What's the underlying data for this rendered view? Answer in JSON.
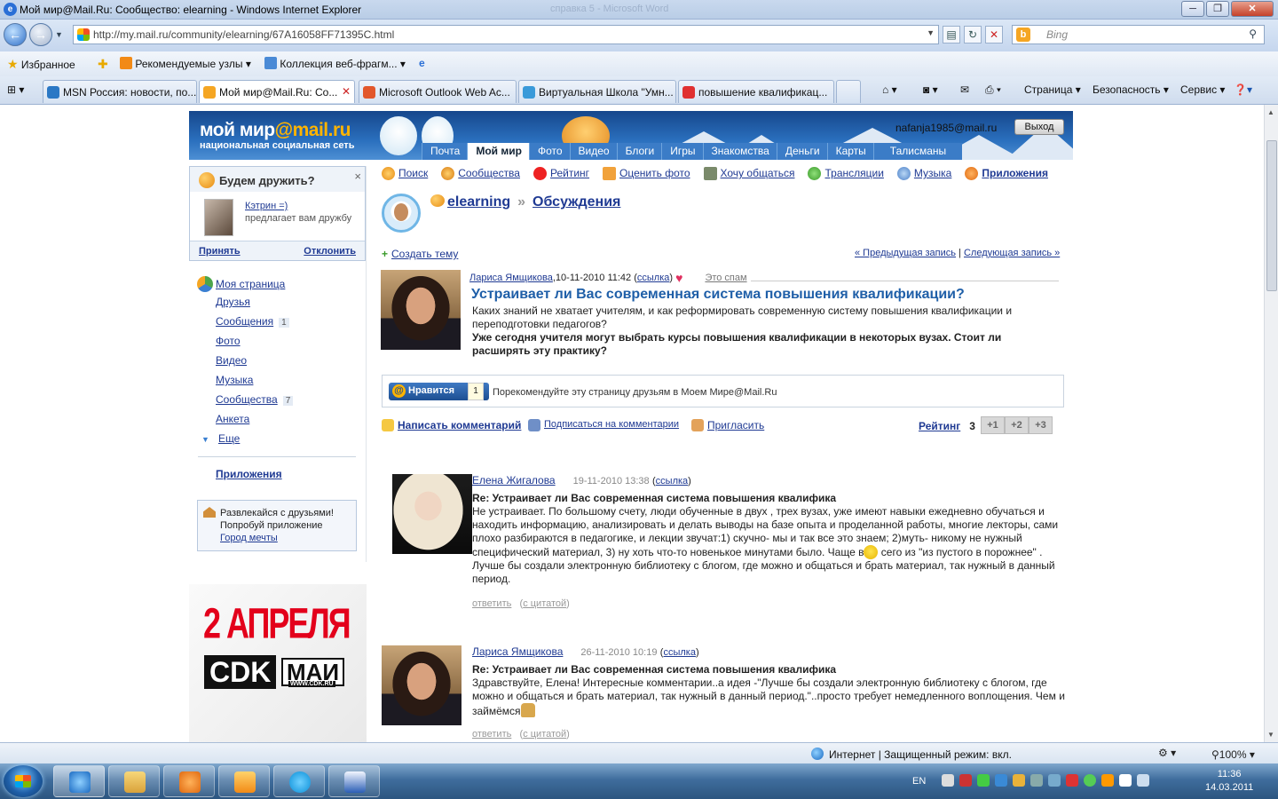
{
  "window": {
    "title": "Мой мир@Mail.Ru: Сообщество: elearning - Windows Internet Explorer",
    "ghost_title": "справка 5 - Microsoft Word",
    "minimize": "─",
    "maximize": "❐",
    "close": "✕"
  },
  "address": {
    "url": "http://my.mail.ru/community/elearning/67A16058FF71395C.html",
    "search_placeholder": "Bing"
  },
  "favorites_bar": {
    "favorites_label": "Избранное",
    "items": [
      "Рекомендуемые узлы ▾",
      "Коллекция веб-фрагм... ▾"
    ]
  },
  "tabs": [
    {
      "label": "MSN Россия: новости, по...",
      "color": "#2b78c5"
    },
    {
      "label": "Мой мир@Mail.Ru: Со...",
      "color": "#f5a623"
    },
    {
      "label": "Microsoft Outlook Web Ac...",
      "color": "#e2572b"
    },
    {
      "label": "Виртуальная Школа \"Умн...",
      "color": "#3a9ad9"
    },
    {
      "label": "повышение квалификац...",
      "color": "#e03030"
    }
  ],
  "commands": [
    "Страница ▾",
    "Безопасность ▾",
    "Сервис ▾"
  ],
  "site": {
    "logo_main": "мой мир",
    "logo_at": "@mail.ru",
    "logo_sub": "национальная социальная сеть",
    "user_email": "nafanja1985@mail.ru",
    "exit_label": "Выход",
    "nav": [
      "Почта",
      "Мой мир",
      "Фото",
      "Видео",
      "Блоги",
      "Игры",
      "Знакомства",
      "Деньги",
      "Карты",
      "Талисманы"
    ]
  },
  "friend_box": {
    "title": "Будем дружить?",
    "close": "×",
    "name": "Кэтрин =)",
    "suggest": "предлагает вам дружбу",
    "accept": "Принять",
    "decline": "Отклонить"
  },
  "left_nav": [
    {
      "label": "Моя страница",
      "count": ""
    },
    {
      "label": "Друзья",
      "count": ""
    },
    {
      "label": "Сообщения",
      "count": "1"
    },
    {
      "label": "Фото",
      "count": ""
    },
    {
      "label": "Видео",
      "count": ""
    },
    {
      "label": "Музыка",
      "count": ""
    },
    {
      "label": "Сообщества",
      "count": "7"
    },
    {
      "label": "Анкета",
      "count": ""
    },
    {
      "label": "Еще",
      "count": ""
    }
  ],
  "apps_label": "Приложения",
  "promo": {
    "line1": "Развлекайся с друзьями!",
    "line2": "Попробуй приложение",
    "link": "Город мечты"
  },
  "banner": {
    "date": "2 АПРЕЛЯ",
    "cdk": "CDK",
    "mai": "МАИ",
    "www": "WWW.CDK.RU"
  },
  "top_nav": [
    "Поиск",
    "Сообщества",
    "Рейтинг",
    "Оценить фото",
    "Хочу общаться",
    "Трансляции",
    "Музыка",
    "Приложения"
  ],
  "breadcrumb": {
    "community": "elearning",
    "sep": "»",
    "section": "Обсуждения"
  },
  "new_topic": "Создать тему",
  "prev_record": "« Предыдущая запись",
  "next_record": "Следующая запись »",
  "post": {
    "author": "Лариса Ямщикова",
    "date": ",10-11-2010 11:42",
    "link": "ссылка",
    "spam": "Это спам",
    "title": "Устраивает ли Вас современная система повышения квалификации?",
    "text": "Каких знаний не хватает учителям, и как реформировать современную систему повышения квалификации и переподготовки педагогов?",
    "bold_text": "Уже сегодня учителя могут выбрать курсы повышения квалификации в некоторых вузах. Стоит ли расширять эту практику?"
  },
  "like": {
    "button": "Нравится",
    "count": "1",
    "text": "Порекомендуйте эту страницу друзьям в Моем Мире@Mail.Ru"
  },
  "actions": {
    "comment": "Написать комментарий",
    "subscribe": "Подписаться на комментарии",
    "invite": "Пригласить"
  },
  "rating": {
    "label": "Рейтинг",
    "value": "3",
    "buttons": [
      "+1",
      "+2",
      "+3"
    ]
  },
  "comments": [
    {
      "author": "Елена Жигалова",
      "date": "19-11-2010 13:38",
      "link": "ссылка",
      "title": "Re: Устраивает ли Вас современная система повышения квалифика",
      "body1": "Не устраивает. По большому счету, люди обученные в двух , трех вузах, уже имеют навыки ежедневно обучаться и находить информацию, анализировать и делать выводы на базе опыта и проделанной работы, многие лекторы, сами плохо разбираются в педагогике, и лекции звучат:1) скучно- мы и так все это знаем; 2)муть- никому не нужный специфический материал, 3) ну хоть что-то новенькое минутами было. Чаще в",
      "body2": " сего из \"из пустого в порожнее\" . Лучше бы создали электронную библиотеку с блогом, где можно и общаться и брать материал, так нужный в данный период.",
      "reply": "ответить",
      "quote": "с цитатой"
    },
    {
      "author": "Лариса Ямщикова",
      "date": "26-11-2010 10:19",
      "link": "ссылка",
      "title": "Re: Устраивает ли Вас современная система повышения квалифика",
      "body1": "Здравствуйте, Елена! Интересные комментарии..а идея -\"Лучше бы создали электронную библиотеку с блогом, где можно и общаться и брать материал, так нужный в данный период.\"..просто требует немедленного воплощения. Чем и займёмся",
      "body2": "",
      "reply": "ответить",
      "quote": "с цитатой"
    }
  ],
  "status": {
    "zone": "Интернет | Защищенный режим: вкл.",
    "zoom": "100%"
  },
  "taskbar": {
    "lang": "EN",
    "time": "11:36",
    "date": "14.03.2011"
  }
}
